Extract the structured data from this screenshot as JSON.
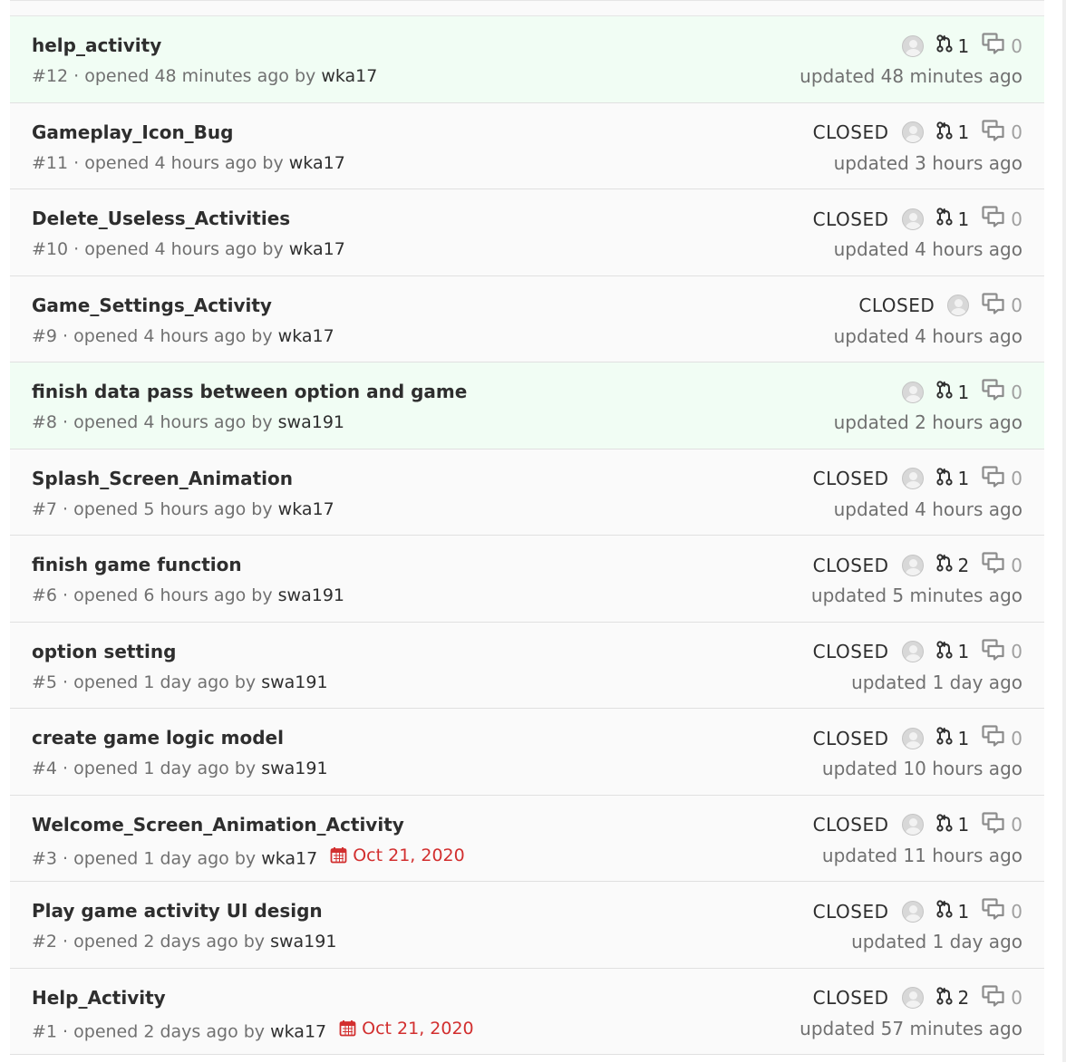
{
  "issues": [
    {
      "title": "help_activity",
      "number": "#12",
      "opened": "opened 48 minutes ago by",
      "author": "wka17",
      "due": "",
      "state": "",
      "mrs": "1",
      "notes": "0",
      "updated": "updated 48 minutes ago"
    },
    {
      "title": "Gameplay_Icon_Bug",
      "number": "#11",
      "opened": "opened 4 hours ago by",
      "author": "wka17",
      "due": "",
      "state": "CLOSED",
      "mrs": "1",
      "notes": "0",
      "updated": "updated 3 hours ago"
    },
    {
      "title": "Delete_Useless_Activities",
      "number": "#10",
      "opened": "opened 4 hours ago by",
      "author": "wka17",
      "due": "",
      "state": "CLOSED",
      "mrs": "1",
      "notes": "0",
      "updated": "updated 4 hours ago"
    },
    {
      "title": "Game_Settings_Activity",
      "number": "#9",
      "opened": "opened 4 hours ago by",
      "author": "wka17",
      "due": "",
      "state": "CLOSED",
      "mrs": "",
      "notes": "0",
      "updated": "updated 4 hours ago"
    },
    {
      "title": "finish data pass between option and game",
      "number": "#8",
      "opened": "opened 4 hours ago by",
      "author": "swa191",
      "due": "",
      "state": "",
      "mrs": "1",
      "notes": "0",
      "updated": "updated 2 hours ago"
    },
    {
      "title": "Splash_Screen_Animation",
      "number": "#7",
      "opened": "opened 5 hours ago by",
      "author": "wka17",
      "due": "",
      "state": "CLOSED",
      "mrs": "1",
      "notes": "0",
      "updated": "updated 4 hours ago"
    },
    {
      "title": "finish game function",
      "number": "#6",
      "opened": "opened 6 hours ago by",
      "author": "swa191",
      "due": "",
      "state": "CLOSED",
      "mrs": "2",
      "notes": "0",
      "updated": "updated 5 minutes ago"
    },
    {
      "title": "option setting",
      "number": "#5",
      "opened": "opened 1 day ago by",
      "author": "swa191",
      "due": "",
      "state": "CLOSED",
      "mrs": "1",
      "notes": "0",
      "updated": "updated 1 day ago"
    },
    {
      "title": "create game logic model",
      "number": "#4",
      "opened": "opened 1 day ago by",
      "author": "swa191",
      "due": "",
      "state": "CLOSED",
      "mrs": "1",
      "notes": "0",
      "updated": "updated 10 hours ago"
    },
    {
      "title": "Welcome_Screen_Animation_Activity",
      "number": "#3",
      "opened": "opened 1 day ago by",
      "author": "wka17",
      "due": "Oct 21, 2020",
      "state": "CLOSED",
      "mrs": "1",
      "notes": "0",
      "updated": "updated 11 hours ago"
    },
    {
      "title": "Play game activity UI design",
      "number": "#2",
      "opened": "opened 2 days ago by",
      "author": "swa191",
      "due": "",
      "state": "CLOSED",
      "mrs": "1",
      "notes": "0",
      "updated": "updated 1 day ago"
    },
    {
      "title": "Help_Activity",
      "number": "#1",
      "opened": "opened 2 days ago by",
      "author": "wka17",
      "due": "Oct 21, 2020",
      "state": "CLOSED",
      "mrs": "2",
      "notes": "0",
      "updated": "updated 57 minutes ago"
    }
  ],
  "colors": {
    "open_row_bg": "#f1fdf4",
    "closed_row_bg": "#fafafa",
    "due_date": "#d22f2f"
  },
  "icons": {
    "merge_request": "merge-request-icon",
    "comments": "comments-icon",
    "calendar": "calendar-icon",
    "avatar": "avatar"
  }
}
